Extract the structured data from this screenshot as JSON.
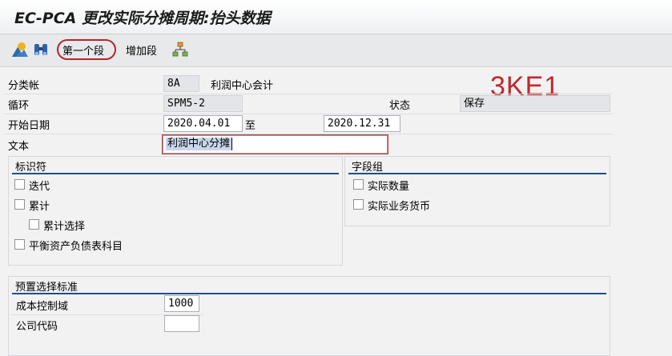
{
  "header": {
    "title": "EC-PCA 更改实际分摊周期:抬头数据"
  },
  "toolbar": {
    "icons": [
      "mountain-sun-icon",
      "binoculars-icon",
      "hierarchy-icon"
    ],
    "first_segment_label": "第一个段",
    "add_segment_label": "增加段"
  },
  "stamp": {
    "text": "3KE1",
    "color": "#c0282d"
  },
  "form": {
    "ledger": {
      "label": "分类帐",
      "value": "8A",
      "description": "利润中心会计"
    },
    "cycle": {
      "label": "循环",
      "value": "SPM5-2"
    },
    "status": {
      "label": "状态",
      "value": "保存"
    },
    "start_date": {
      "label": "开始日期",
      "from": "2020.04.01",
      "to_label": "至",
      "to": "2020.12.31"
    },
    "text": {
      "label": "文本",
      "value": "利润中心分摊"
    }
  },
  "identifiers": {
    "title": "标识符",
    "iterative": {
      "label": "迭代",
      "checked": false
    },
    "cumulative": {
      "label": "累计",
      "checked": false
    },
    "cumulative_selection": {
      "label": "累计选择",
      "checked": false
    },
    "balance_sheet": {
      "label": "平衡资产负债表科目",
      "checked": false
    }
  },
  "field_groups": {
    "title": "字段组",
    "actual_quantity": {
      "label": "实际数量",
      "checked": false
    },
    "actual_business_currency": {
      "label": "实际业务货币",
      "checked": false
    }
  },
  "presets": {
    "title": "预置选择标准",
    "controlling_area": {
      "label": "成本控制域",
      "value": "1000"
    },
    "company_code": {
      "label": "公司代码",
      "value": ""
    }
  },
  "colors": {
    "accent_rule": "#1e4f8c",
    "highlight_ring": "#b3262d"
  }
}
